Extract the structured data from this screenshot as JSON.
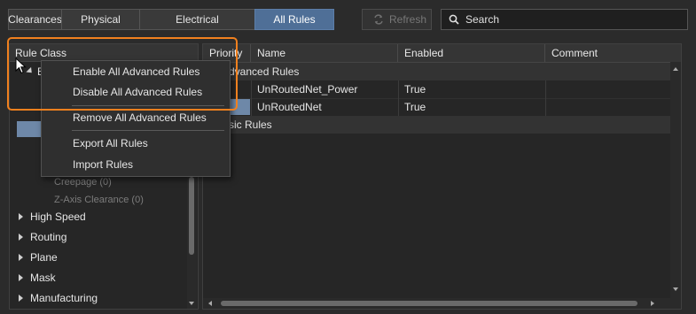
{
  "tabs": [
    {
      "label": "Clearances",
      "active": false
    },
    {
      "label": "Physical",
      "active": false
    },
    {
      "label": "Electrical",
      "active": false
    },
    {
      "label": "All Rules",
      "active": true
    }
  ],
  "toolbar": {
    "refresh_label": "Refresh",
    "refresh_enabled": false
  },
  "search": {
    "placeholder": "Search",
    "value": ""
  },
  "rule_class_panel": {
    "header": "Rule Class",
    "root_label": "E",
    "sub_items": [
      "Creepage (0)",
      "Z-Axis Clearance (0)"
    ],
    "categories": [
      "High Speed",
      "Routing",
      "Plane",
      "Mask",
      "Manufacturing"
    ]
  },
  "rules_grid": {
    "columns": [
      "Priority",
      "Name",
      "Enabled",
      "Comment"
    ],
    "groups": [
      {
        "label": "dvanced Rules",
        "rows": [
          {
            "priority": "",
            "name": "UnRoutedNet_Power",
            "enabled": "True",
            "comment": ""
          },
          {
            "priority": "",
            "name": "UnRoutedNet",
            "enabled": "True",
            "comment": ""
          }
        ]
      },
      {
        "label": "sic Rules",
        "rows": []
      }
    ]
  },
  "context_menu": {
    "items": [
      "Enable All Advanced Rules",
      "Disable All Advanced Rules",
      "Remove All Advanced Rules",
      "Export All Rules",
      "Import Rules"
    ]
  },
  "colors": {
    "active_tab": "#4f6f97",
    "highlight_outline": "#f0801e",
    "selection": "#6e88a8",
    "background": "#2b2b2b"
  },
  "icons": {
    "refresh": "refresh-icon",
    "search": "search-icon",
    "cursor": "mouse-cursor-icon"
  }
}
